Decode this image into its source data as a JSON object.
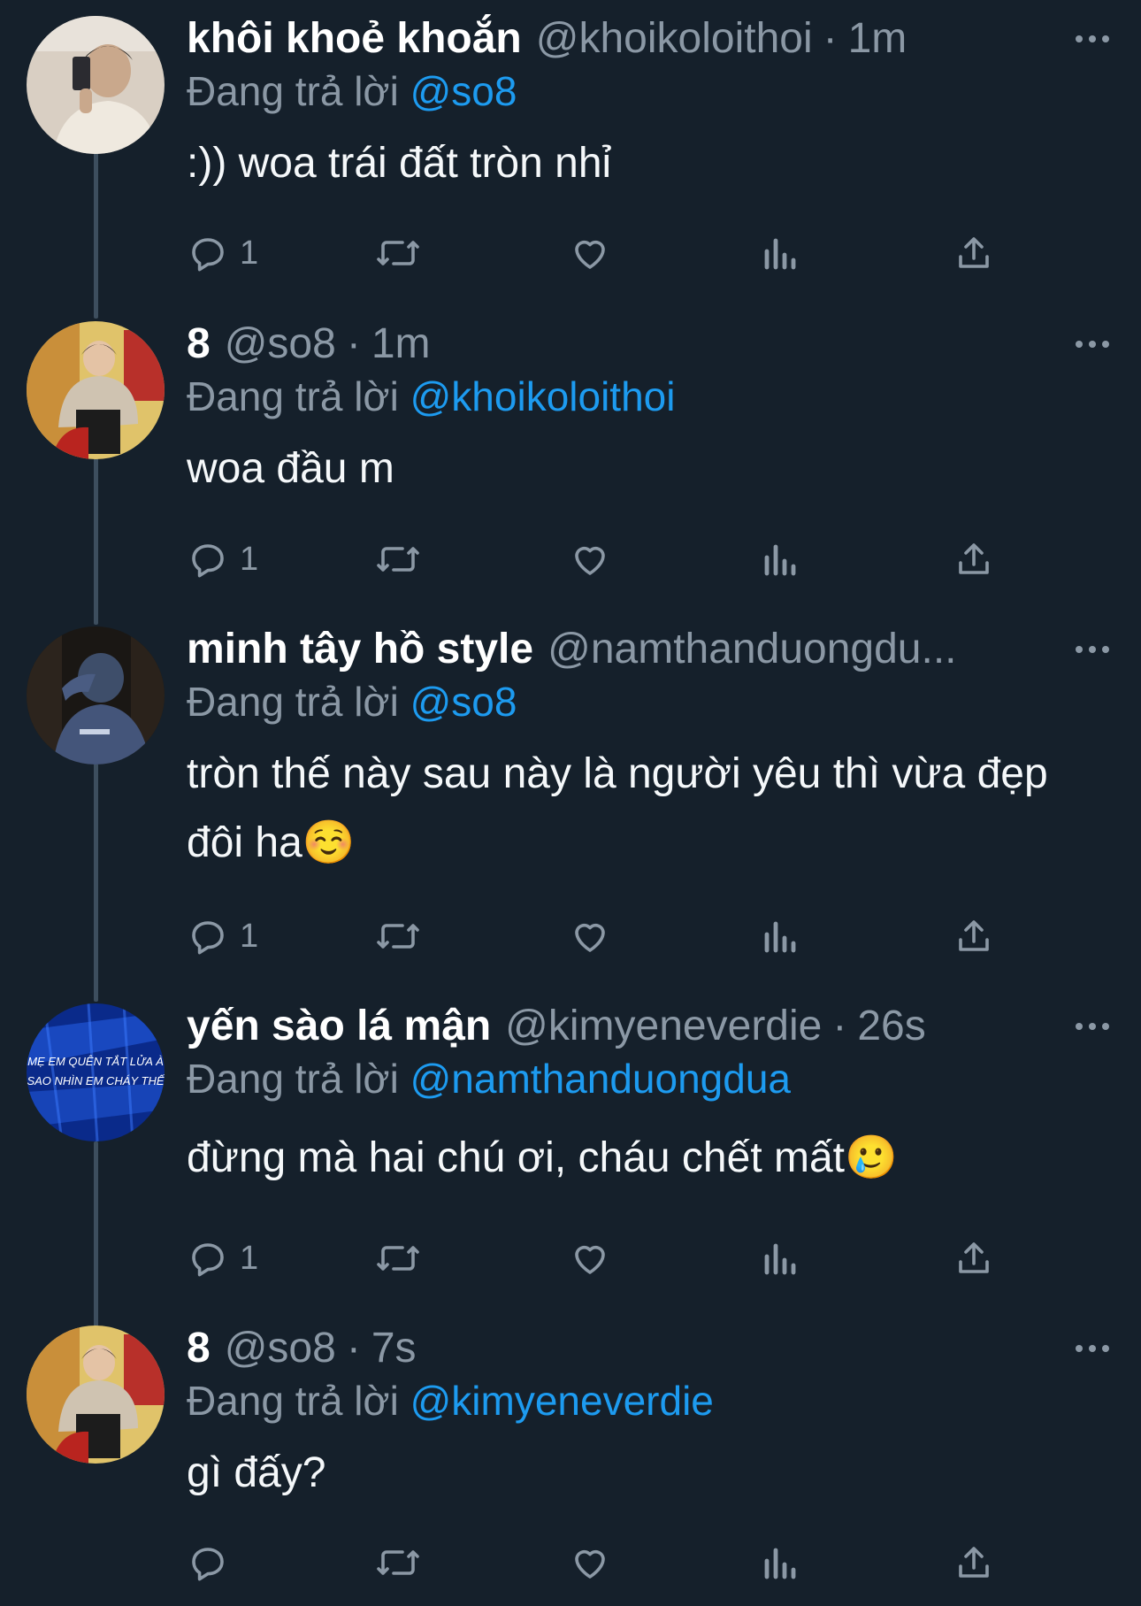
{
  "tweets": [
    {
      "display_name": "khôi khoẻ khoắn",
      "handle": "@khoikoloithoi",
      "time": "1m",
      "reply_prefix": "Đang trả lời",
      "reply_to": "@so8",
      "text": ":)) woa trái đất tròn nhỉ",
      "reply_count": "1",
      "avatar": "avatar-selfie"
    },
    {
      "display_name": "8",
      "handle": "@so8",
      "time": "1m",
      "reply_prefix": "Đang trả lời",
      "reply_to": "@khoikoloithoi",
      "text": "woa đầu m",
      "reply_count": "1",
      "avatar": "avatar-sitting"
    },
    {
      "display_name": "minh tây hồ style",
      "handle": "@namthanduongdu...",
      "time": "",
      "reply_prefix": "Đang trả lời",
      "reply_to": "@so8",
      "text": "tròn thế này sau này là người yêu thì vừa đẹp đôi ha☺️",
      "reply_count": "1",
      "avatar": "avatar-hoodie"
    },
    {
      "display_name": "yến sào lá mận",
      "handle": "@kimyeneverdie",
      "time": "26s",
      "reply_prefix": "Đang trả lời",
      "reply_to": "@namthanduongdua",
      "text": "đừng mà hai chú ơi, cháu chết mất🥲",
      "reply_count": "1",
      "avatar": "avatar-blue-text",
      "avatar_text": [
        "MẸ EM QUÊN TẮT LỬA À",
        "SAO NHÌN EM CHÁY THẾ"
      ]
    },
    {
      "display_name": "8",
      "handle": "@so8",
      "time": "7s",
      "reply_prefix": "Đang trả lời",
      "reply_to": "@kimyeneverdie",
      "text": "gì đấy?",
      "reply_count": "",
      "avatar": "avatar-sitting"
    }
  ],
  "icons": [
    "reply-icon",
    "retweet-icon",
    "like-icon",
    "views-icon",
    "share-icon",
    "more-icon"
  ],
  "colors": {
    "background": "#15202b",
    "text": "#ffffff",
    "muted": "#8b98a5",
    "mention": "#1d9bf0",
    "thread_line": "#3d4e5e"
  }
}
